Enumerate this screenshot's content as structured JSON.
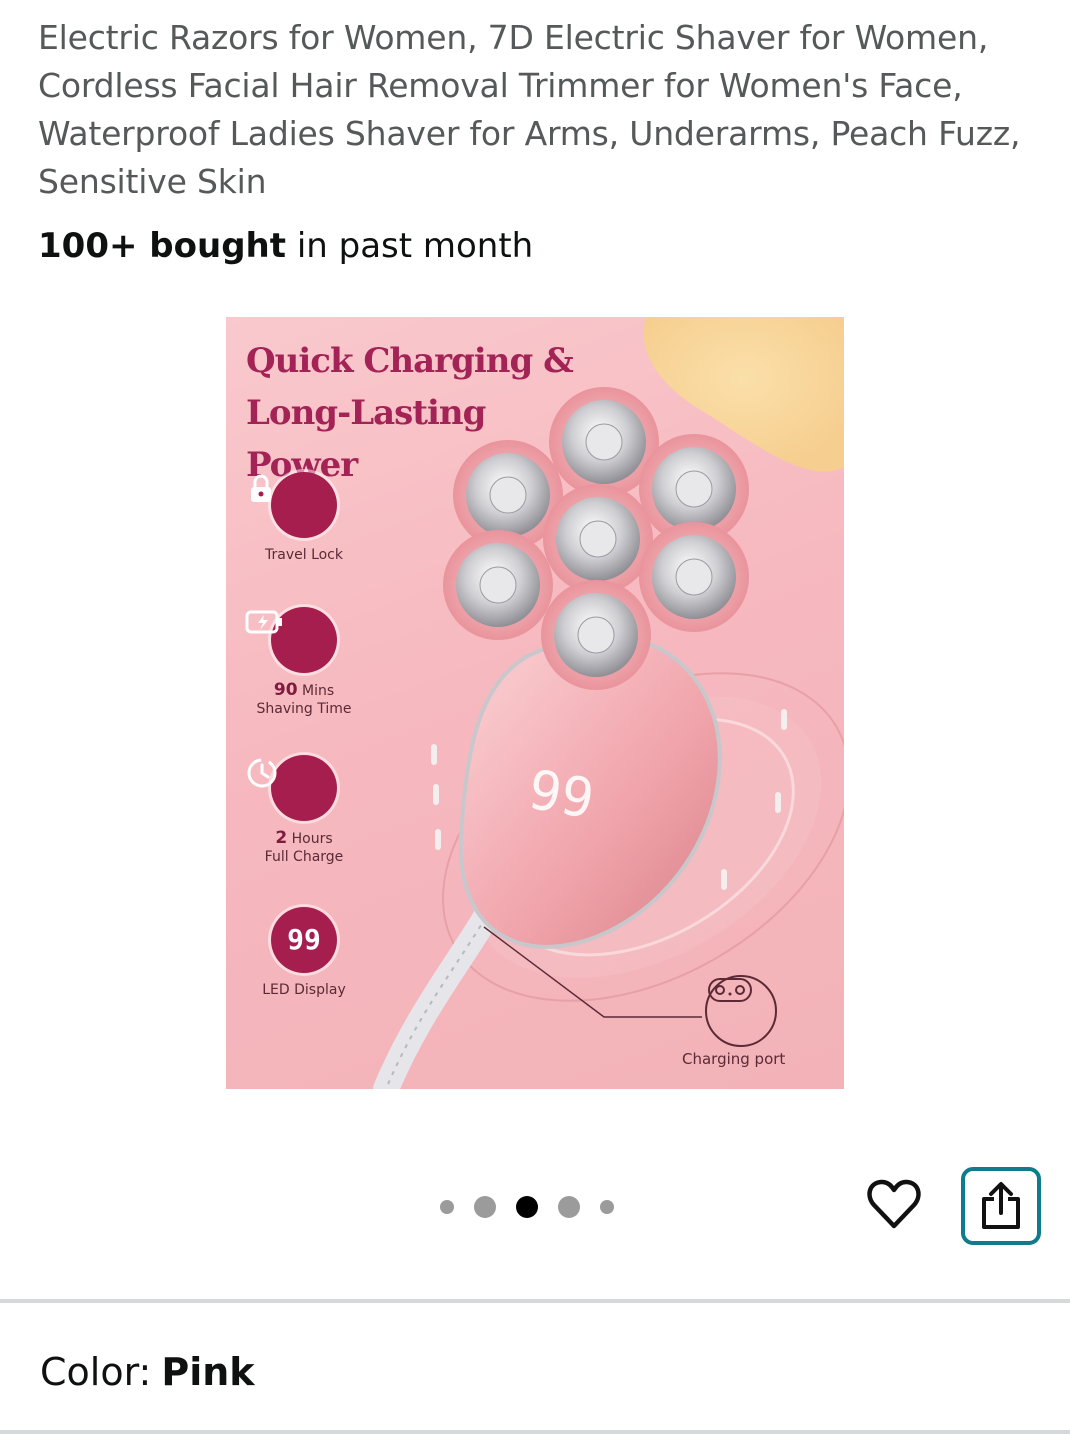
{
  "product": {
    "title": "Electric Razors for Women, 7D Electric Shaver for Women, Cordless Facial Hair Removal Trimmer for Women's Face, Waterproof Ladies Shaver for Arms, Underarms, Peach Fuzz, Sensitive Skin",
    "bought_count": "100+ bought",
    "bought_suffix": "in past month"
  },
  "image": {
    "headline": "Quick Charging & Long-Lasting Power",
    "features": [
      {
        "icon": "lock-icon",
        "label": "Travel Lock",
        "num": "",
        "unit": "",
        "sub": ""
      },
      {
        "icon": "battery-charge-icon",
        "label": "",
        "num": "90",
        "unit": "Mins",
        "sub": "Shaving Time"
      },
      {
        "icon": "clock-icon",
        "label": "",
        "num": "2",
        "unit": "Hours",
        "sub": "Full Charge"
      },
      {
        "icon": "led-display-icon",
        "label": "LED Display",
        "num": "",
        "unit": "",
        "sub": ""
      }
    ],
    "led_value": "99",
    "charging_port_label": "Charging port"
  },
  "carousel": {
    "total_dots": 5,
    "active_index": 2
  },
  "actions": {
    "wishlist_icon": "heart-icon",
    "share_icon": "share-icon"
  },
  "variation": {
    "color_label": "Color:",
    "color_value": "Pink"
  },
  "colors": {
    "accent_share": "#0f7b8c",
    "headline": "#a42356",
    "feature_circle": "#a51e4e"
  }
}
